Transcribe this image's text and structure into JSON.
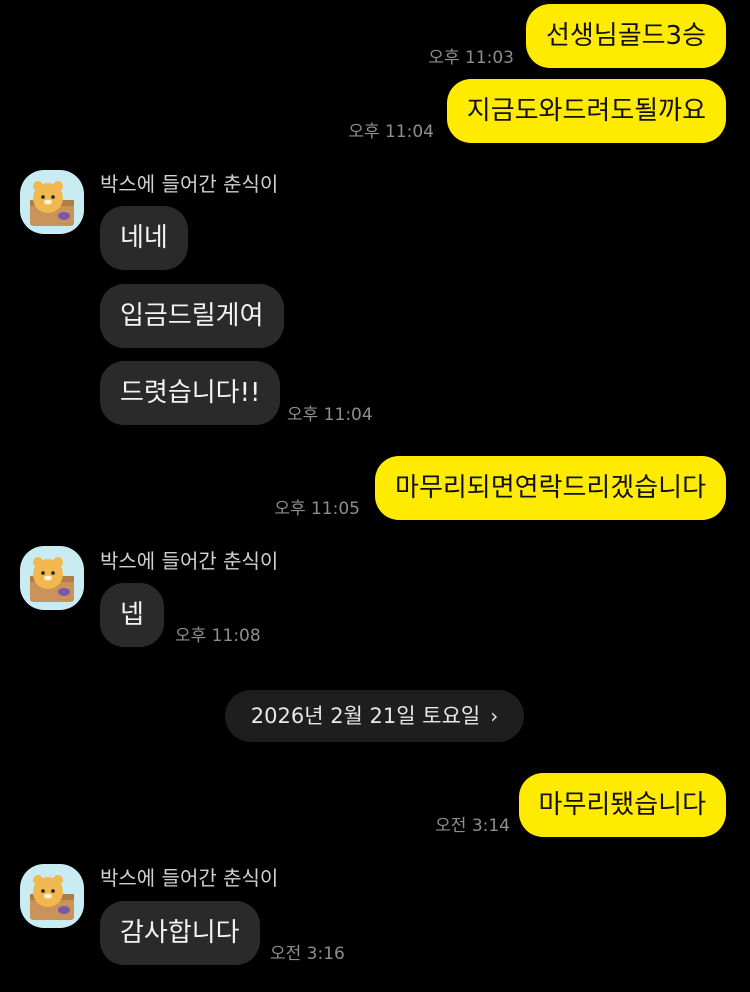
{
  "messages": {
    "m1": {
      "text": "선생님골드3승",
      "time": "오후 11:03"
    },
    "m2": {
      "text": "지금도와드려도될까요",
      "time": "오후 11:04"
    },
    "g1": {
      "sender": "박스에 들어간 춘식이",
      "b1": "네네",
      "b2": "입금드릴게여",
      "b3": "드렷습니다!!",
      "time": "오후 11:04"
    },
    "m3": {
      "text": "마무리되면연락드리겠습니다",
      "time": "오후 11:05"
    },
    "g2": {
      "sender": "박스에 들어간 춘식이",
      "b1": "넵",
      "time": "오후 11:08"
    },
    "date_separator": "2026년 2월 21일 토요일",
    "m4": {
      "text": "마무리됐습니다",
      "time": "오전 3:14"
    },
    "g3": {
      "sender": "박스에 들어간 춘식이",
      "b1": "감사합니다",
      "time": "오전 3:16"
    }
  },
  "icons": {
    "avatar": "choonsik-in-box-avatar",
    "date_chevron": "chevron-right-icon"
  },
  "colors": {
    "background": "#000000",
    "my_bubble": "#ffeb00",
    "their_bubble": "#2a2a2a",
    "avatar_bg": "#c9ecf2"
  }
}
